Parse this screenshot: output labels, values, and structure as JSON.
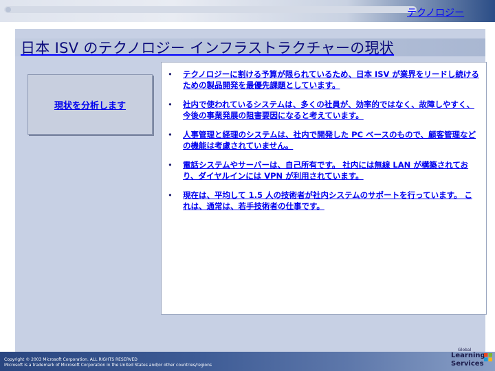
{
  "header": {
    "section_label": "テクノロジー"
  },
  "title": "日本 ISV のテクノロジー インフラストラクチャーの現状",
  "left_box": {
    "label": "現状を分析します"
  },
  "bullets": [
    {
      "marker": "•",
      "text": "テクノロジーに割ける予算が限られているため、日本 ISV が業界をリードし続けるための製品開発を最優先課題としています。"
    },
    {
      "marker": "•",
      "text": "社内で使われているシステムは、多くの社員が、効率的ではなく、故障しやすく、今後の事業発展の阻害要因になると考えています。"
    },
    {
      "marker": "•",
      "text": "人事管理と経理のシステムは、社内で開発した PC ベースのもので、顧客管理などの機能は考慮されていません。"
    },
    {
      "marker": "•",
      "text": "電話システムやサーバーは、自己所有です。 社内には無線 LAN が構築されており、ダイヤルインには VPN が利用されています。"
    },
    {
      "marker": "•",
      "text": "現在は、平均して 1.5 人の技術者が社内システムのサポートを行っています。 これは、通常は、若手技術者の仕事です。"
    }
  ],
  "footer": {
    "copyright_line1": "Copyright © 2003 Microsoft Corporation. ALL RIGHTS RESERVED",
    "copyright_line2": "Microsoft is a trademark of Microsoft Corporation in the United States and/or other countries/regions"
  },
  "logo": {
    "global": "Global",
    "line1": "Learning",
    "line2": "Services",
    "flag_colors": [
      "#e8451e",
      "#7cb82f",
      "#1d9bd8",
      "#f7b614"
    ]
  }
}
